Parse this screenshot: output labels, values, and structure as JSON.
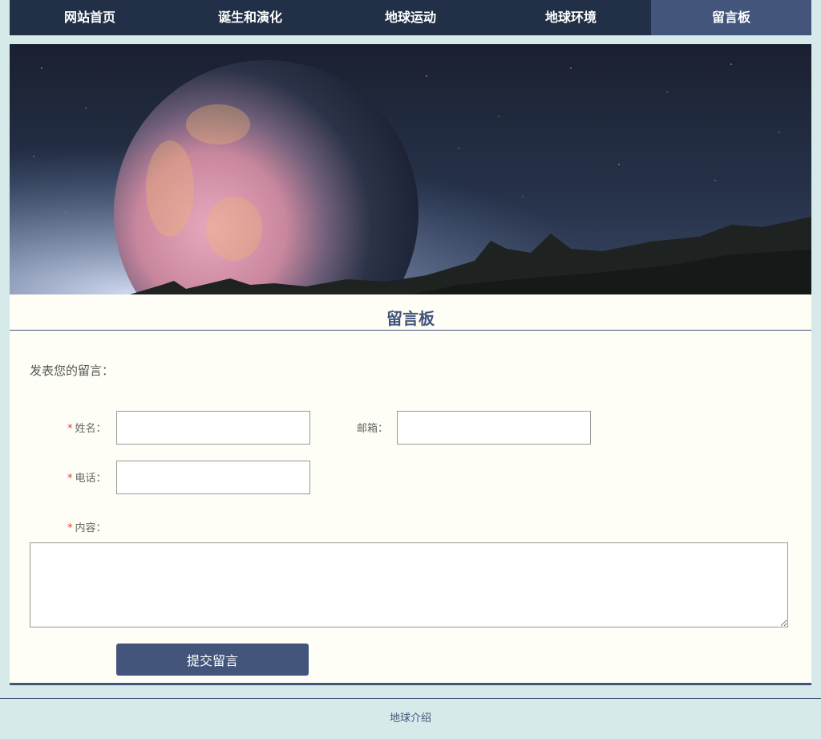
{
  "nav": {
    "items": [
      {
        "label": "网站首页"
      },
      {
        "label": "诞生和演化"
      },
      {
        "label": "地球运动"
      },
      {
        "label": "地球环境"
      },
      {
        "label": "留言板"
      }
    ],
    "active_index": 4
  },
  "page": {
    "title": "留言板",
    "intro": "发表您的留言："
  },
  "form": {
    "name_label": "姓名：",
    "email_label": "邮箱：",
    "phone_label": "电话：",
    "content_label": "内容：",
    "required_mark": "*",
    "name_value": "",
    "email_value": "",
    "phone_value": "",
    "content_value": "",
    "submit_label": "提交留言"
  },
  "footer": {
    "text": "地球介绍"
  },
  "colors": {
    "nav_bg": "#223047",
    "nav_active": "#43557a",
    "accent": "#43557a",
    "content_bg": "#fefef6",
    "page_bg": "#d6eaea",
    "required": "#e23b2e"
  }
}
